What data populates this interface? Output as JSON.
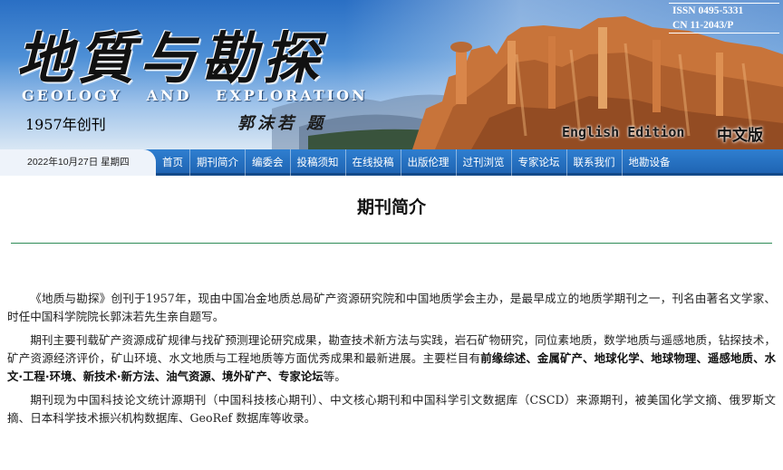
{
  "banner": {
    "title_cn": "地質与勘探",
    "title_en": "GEOLOGY AND EXPLORATION",
    "founded": "1957年创刊",
    "calligraphy": "郭沫若 题",
    "issn": "ISSN 0495-5331",
    "cn": "CN 11-2043/P",
    "english_edition": "English Edition",
    "chinese_edition": "中文版"
  },
  "nav": {
    "date": "2022年10月27日 星期四",
    "items": [
      {
        "label": "首页"
      },
      {
        "label": "期刊简介"
      },
      {
        "label": "编委会"
      },
      {
        "label": "投稿须知"
      },
      {
        "label": "在线投稿"
      },
      {
        "label": "出版伦理"
      },
      {
        "label": "过刊浏览"
      },
      {
        "label": "专家论坛"
      },
      {
        "label": "联系我们"
      },
      {
        "label": "地勘设备"
      }
    ]
  },
  "main": {
    "page_title": "期刊简介",
    "paragraph1": "《地质与勘探》创刊于1957年，现由中国冶金地质总局矿产资源研究院和中国地质学会主办，是最早成立的地质学期刊之一，刊名由著名文学家、时任中国科学院院长郭沫若先生亲自题写。",
    "paragraph2_intro": "期刊主要刊载矿产资源成矿规律与找矿预测理论研究成果，勘查技术新方法与实践，岩石矿物研究，同位素地质，数学地质与遥感地质，钻探技术，矿产资源经济评价，矿山环境、水文地质与工程地质等方面优秀成果和最新进展。主要栏目有",
    "paragraph2_columns": "前缘综述、金属矿产、地球化学、地球物理、遥感地质、水文·工程·环境、新技术·新方法、油气资源、境外矿产、专家论坛",
    "paragraph2_end": "等。",
    "paragraph3": "期刊现为中国科技论文统计源期刊（中国科技核心期刊）、中文核心期刊和中国科学引文数据库（CSCD）来源期刊，被美国化学文摘、俄罗斯文摘、日本科学技术振兴机构数据库、GeoRef 数据库等收录。"
  },
  "colors": {
    "nav_blue": "#1f64b3",
    "divider_green": "#2e8b57",
    "rock_orange": "#c8743a"
  }
}
